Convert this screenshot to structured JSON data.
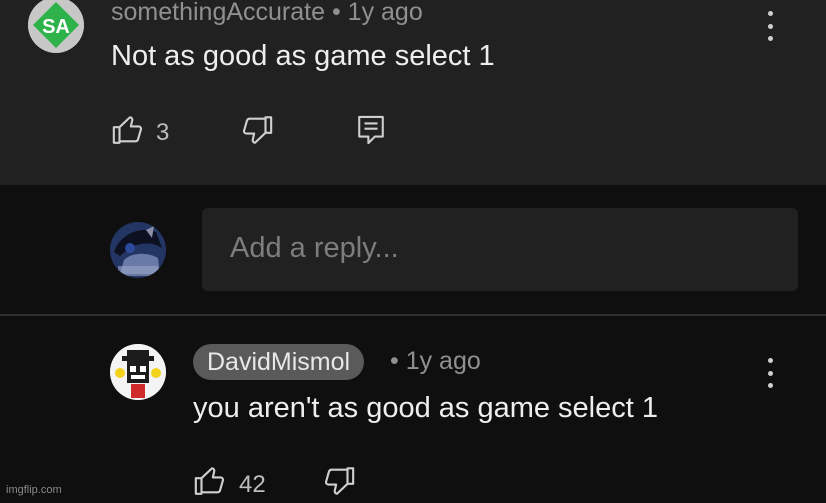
{
  "comment": {
    "author": "somethingAccurate",
    "time": "• 1y ago",
    "text": "Not as good as game select 1",
    "like_count": "3",
    "avatar_initials": "SA"
  },
  "reply_input": {
    "placeholder": "Add a reply..."
  },
  "reply": {
    "author": "DavidMismol",
    "time": "• 1y ago",
    "text": "you aren't as good as game select 1",
    "like_count": "42"
  },
  "watermark": "imgflip.com",
  "colors": {
    "background": "#0f0f0f",
    "comment_surface": "#212121",
    "avatar_green": "#2db34a",
    "pill": "#5a5a5a"
  }
}
